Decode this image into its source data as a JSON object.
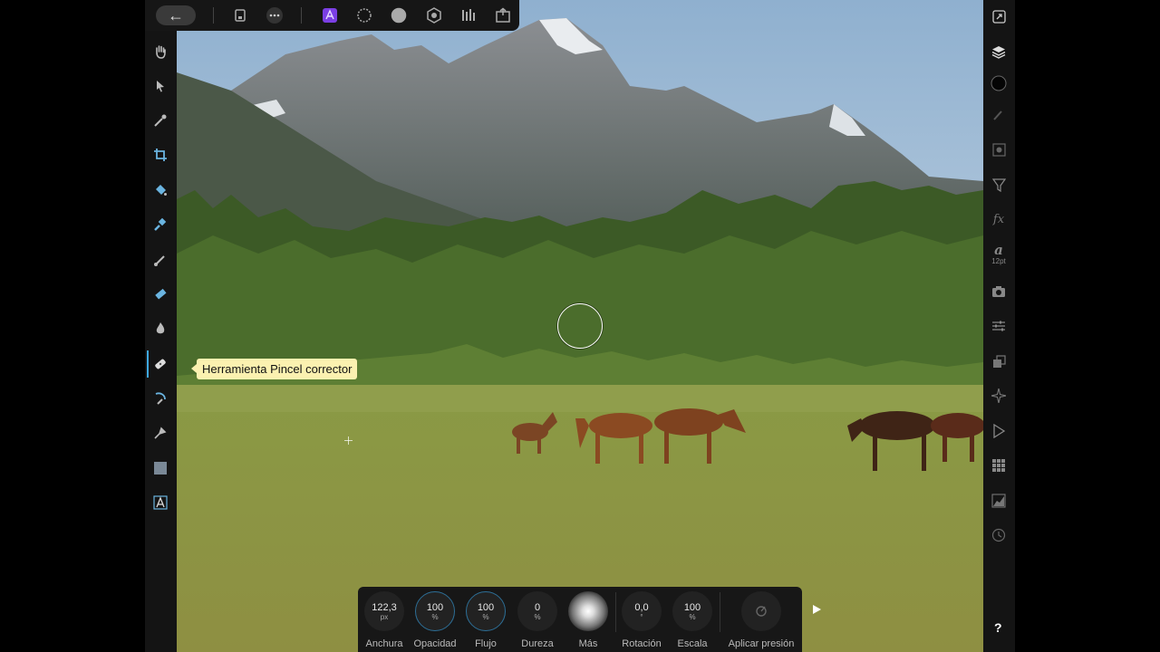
{
  "topbar": {
    "back_icon": "arrow-left-icon",
    "back_glyph": "←",
    "items": [
      {
        "name": "document-icon"
      },
      {
        "name": "more-icon"
      },
      {
        "name": "photo-persona-icon"
      },
      {
        "name": "liquify-persona-icon"
      },
      {
        "name": "develop-persona-icon"
      },
      {
        "name": "tone-mapping-persona-icon"
      },
      {
        "name": "export-persona-icon"
      },
      {
        "name": "share-icon"
      }
    ]
  },
  "tooltip": {
    "text": "Herramienta Pincel corrector"
  },
  "context_toolbar": {
    "controls": [
      {
        "value": "122,3",
        "unit": "px",
        "label": "Anchura"
      },
      {
        "value": "100",
        "unit": "%",
        "label": "Opacidad"
      },
      {
        "value": "100",
        "unit": "%",
        "label": "Flujo"
      },
      {
        "value": "0",
        "unit": "%",
        "label": "Dureza"
      },
      {
        "value": "",
        "unit": "",
        "label": "Más"
      },
      {
        "value": "0,0",
        "unit": "°",
        "label": "Rotación"
      },
      {
        "value": "100",
        "unit": "%",
        "label": "Escala"
      },
      {
        "value": "",
        "unit": "",
        "label": "Aplicar presión"
      }
    ]
  },
  "studio": {
    "text_style_size": "12pt",
    "fx_label": "fx",
    "text_glyph": "a",
    "help": "?"
  },
  "colors": {
    "accent": "#3ea7e0",
    "persona_active": "#7b3fe4",
    "tooltip_bg": "#fbf1b0"
  }
}
